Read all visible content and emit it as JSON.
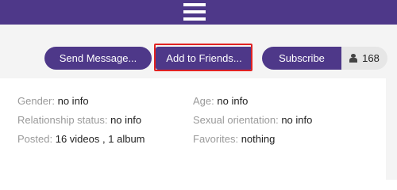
{
  "header": {
    "menu_icon": "hamburger-menu-icon",
    "bg_color": "#4e3889"
  },
  "actions": {
    "send_message_label": "Send Message...",
    "add_friends_label": "Add to Friends...",
    "subscribe_label": "Subscribe",
    "subscriber_count": "168",
    "subscriber_icon": "user-icon",
    "highlight_color": "#e02222"
  },
  "profile": {
    "gender": {
      "label": "Gender:",
      "value": "no info"
    },
    "age": {
      "label": "Age:",
      "value": "no info"
    },
    "relationship": {
      "label": "Relationship status:",
      "value": "no info"
    },
    "orientation": {
      "label": "Sexual orientation:",
      "value": "no info"
    },
    "posted": {
      "label": "Posted:",
      "videos": "16 videos",
      "sep": ",",
      "albums": "1 album"
    },
    "favorites": {
      "label": "Favorites:",
      "value": "nothing"
    }
  }
}
